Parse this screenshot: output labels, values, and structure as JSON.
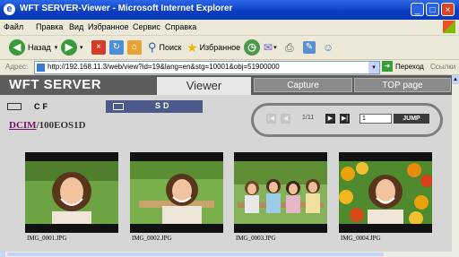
{
  "window": {
    "title": "WFT SERVER-Viewer - Microsoft Internet Explorer",
    "minimize": "_",
    "maximize": "□",
    "close": "×"
  },
  "menu": [
    "Файл",
    "Правка",
    "Вид",
    "Избранное",
    "Сервис",
    "Справка"
  ],
  "toolbar": {
    "back_label": "Назад",
    "search_label": "Поиск",
    "favorites_label": "Избранное"
  },
  "address": {
    "label": "Адрес:",
    "url": "http://192.168.11.3/web/view?id=19&lang=en&stg=10001&obj=51900000",
    "go_label": "Переход",
    "links_label": "Ссылки"
  },
  "page": {
    "brand": "WFT SERVER",
    "tabs": {
      "viewer": "Viewer",
      "capture": "Capture",
      "top": "TOP page"
    },
    "cards": {
      "cf": "CF",
      "sd": "SD"
    },
    "path": {
      "link": "DCIM",
      "rest": "/100EOS1D"
    },
    "pager": {
      "count": "1/11",
      "page_value": "1",
      "jump": "JUMP"
    },
    "thumbnails": [
      {
        "filename": "IMG_0001.JPG"
      },
      {
        "filename": "IMG_0002.JPG"
      },
      {
        "filename": "IMG_0003.JPG"
      },
      {
        "filename": "IMG_0004.JPG"
      }
    ]
  },
  "colors": {
    "title_bar": "#0a3dbf",
    "header_bg": "#5d5d5d",
    "sd_tab": "#4b5a8a",
    "content_bg": "#d6d6d6",
    "path_link": "#7a0d6b"
  }
}
